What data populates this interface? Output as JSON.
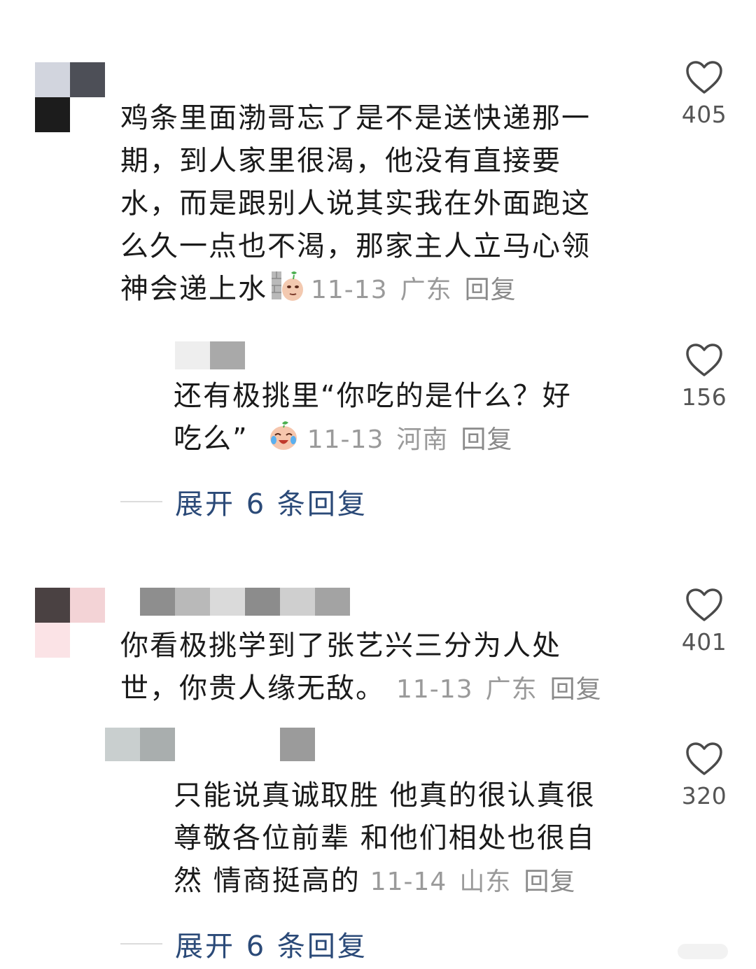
{
  "comments": [
    {
      "avatar_colors": [
        "#d2d5de",
        "#4d4f57",
        "#1c1c1c",
        "#ffffff"
      ],
      "name_mosaic_colors": [],
      "text_lines": [
        "鸡条里面渤哥忘了是不是送快递那一",
        "期，到人家里很渴，他没有直接要",
        "水，而是跟别人说其实我在外面跑这",
        "么久一点也不渴，那家主人立马心领",
        "神会递上水"
      ],
      "emoji": "wall-peek-emoji",
      "date": "11-13",
      "location": "广东",
      "reply_label": "回复",
      "likes": "405"
    },
    {
      "avatar_colors": [],
      "name_mosaic_colors": [
        "#eeeeee",
        "#a9a9a9"
      ],
      "text_lines": [
        "还有极挑里“你吃的是什么？好",
        "吃么”"
      ],
      "emoji": "crying-laugh-emoji",
      "date": "11-13",
      "location": "河南",
      "reply_label": "回复",
      "likes": "156"
    },
    {
      "avatar_colors": [
        "#4a4142",
        "#f3d3d6",
        "#fbe3e6",
        "#ffffff"
      ],
      "name_mosaic_colors": [
        "#8e8e8e",
        "#b9b9b9",
        "#dadada",
        "#8c8c8c",
        "#cfcfcf",
        "#a3a3a3"
      ],
      "text_lines": [
        "你看极挑学到了张艺兴三分为人处",
        "世，你贵人缘无敌。"
      ],
      "date": "11-13",
      "location": "广东",
      "reply_label": "回复",
      "likes": "401"
    },
    {
      "avatar_colors": [],
      "name_mosaic_colors": [
        "#c9cfcf",
        "#a9aeae",
        "#ffffff",
        "#ffffff",
        "#ffffff",
        "#9b9b9b"
      ],
      "text_lines": [
        "只能说真诚取胜 他真的很认真很",
        "尊敬各位前辈 和他们相处也很自",
        "然 情商挺高的"
      ],
      "date": "11-14",
      "location": "山东",
      "reply_label": "回复",
      "likes": "320"
    }
  ],
  "expand_replies": [
    {
      "label": "展开 6 条回复"
    },
    {
      "label": "展开 6 条回复"
    }
  ],
  "colors": {
    "text": "#1a1a1a",
    "meta": "#9a9a9a",
    "expand_link": "#2b4a78",
    "heart_stroke": "#4a4a4a"
  }
}
